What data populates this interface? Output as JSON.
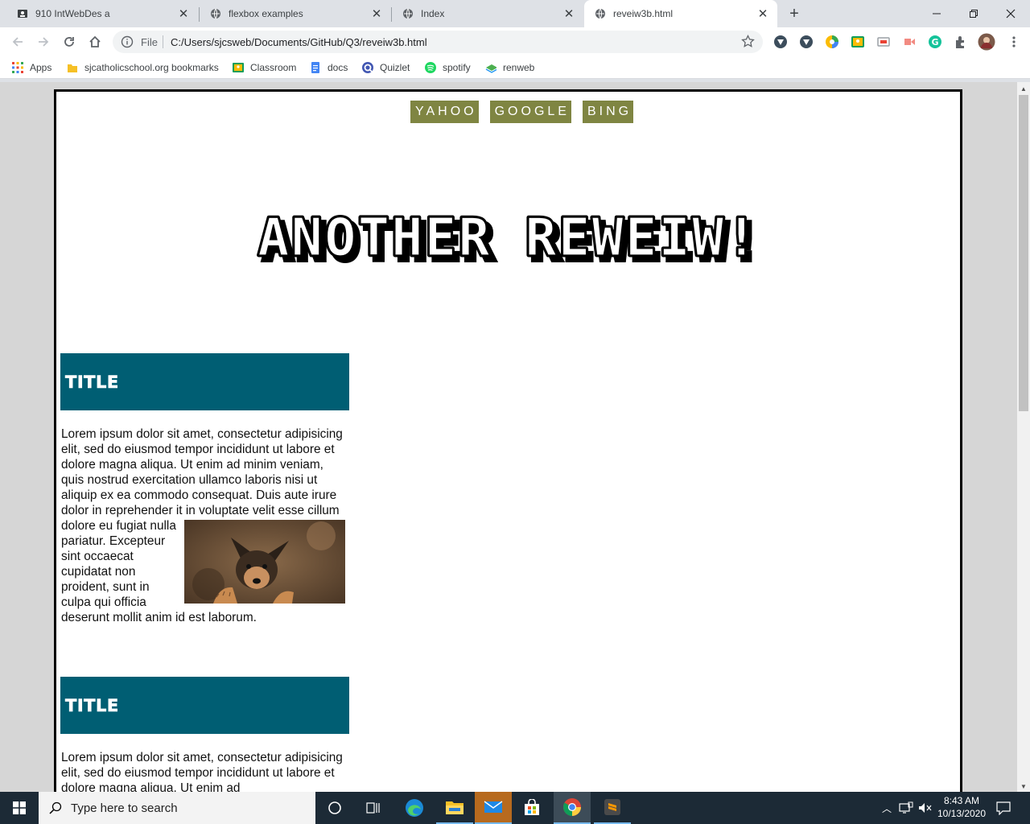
{
  "browser": {
    "tabs": [
      {
        "title": "910 IntWebDes a",
        "icon": "classroom-icon"
      },
      {
        "title": "flexbox examples",
        "icon": "globe-icon"
      },
      {
        "title": "Index",
        "icon": "globe-icon"
      },
      {
        "title": "reveiw3b.html",
        "icon": "globe-icon",
        "active": true
      }
    ],
    "address": {
      "scheme_label": "File",
      "url": "C:/Users/sjcsweb/Documents/GitHub/Q3/reveiw3b.html"
    },
    "bookmarks": [
      {
        "label": "Apps",
        "icon": "apps-grid-icon"
      },
      {
        "label": "sjcatholicschool.org bookmarks",
        "icon": "folder-icon"
      },
      {
        "label": "Classroom",
        "icon": "classroom-icon"
      },
      {
        "label": "docs",
        "icon": "docs-icon"
      },
      {
        "label": "Quizlet",
        "icon": "quizlet-icon"
      },
      {
        "label": "spotify",
        "icon": "spotify-icon"
      },
      {
        "label": "renweb",
        "icon": "renweb-icon"
      }
    ]
  },
  "page": {
    "nav": [
      {
        "label": "YAHOO"
      },
      {
        "label": "GOOGLE"
      },
      {
        "label": "BING"
      }
    ],
    "heading": "ANOTHER REWEIW!",
    "cards": [
      {
        "title": "TITLE",
        "body_lead": "Lorem ipsum dolor sit amet, consectetur adipisicing elit, sed do eiusmod tempor incididunt ut labore et dolore magna aliqua. Ut enim ad minim veniam, quis nostrud exercitation ullamco laboris nisi ut aliquip ex ea commodo consequat. Duis aute irure dolor in reprehender it in voluptate",
        "body_wrap": "velit esse cillum dolore eu fugiat nulla pariatur. Excepteur sint occaecat cupidatat non proident, sunt in culpa qui officia deserunt mollit anim id est laborum.",
        "image": "puppy-photo"
      },
      {
        "title": "TITLE",
        "body_lead": "Lorem ipsum dolor sit amet, consectetur adipisicing elit, sed do eiusmod tempor incididunt ut labore et dolore magna aliqua. Ut enim ad",
        "body_wrap": ""
      }
    ]
  },
  "taskbar": {
    "search_placeholder": "Type here to search",
    "time": "8:43 AM",
    "date": "10/13/2020"
  },
  "colors": {
    "nav_bg": "#7f8542",
    "card_header_bg": "#005e73",
    "page_border": "#000000",
    "taskbar_bg": "#1c2a36"
  }
}
